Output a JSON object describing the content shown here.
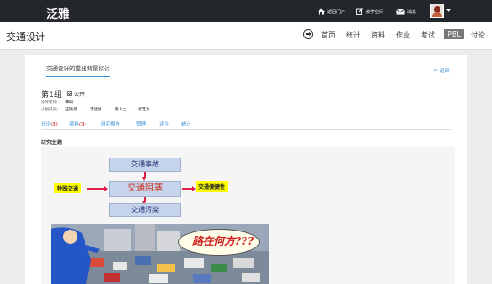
{
  "topbar": {
    "brand": "泛雅",
    "links": [
      "返回门户",
      "教学空间",
      "消息"
    ]
  },
  "header": {
    "title": "交通设计",
    "nav": [
      "首页",
      "统计",
      "资料",
      "作业",
      "考试",
      "PBL",
      "讨论"
    ],
    "active_nav": "PBL"
  },
  "panel": {
    "tab": "交通设计的提出背景探讨",
    "back": "返回",
    "group_name": "第1组",
    "public_label": "公开",
    "teacher_label": "指导教师：",
    "teacher": "朱琪",
    "members_label": "小组成员：",
    "members": [
      "王晓月",
      "李佳妮",
      "荆人士",
      "郑芝龙"
    ],
    "tabs": [
      {
        "label": "讨论",
        "count": "(3)"
      },
      {
        "label": "资料",
        "count": "(3)"
      },
      {
        "label": "研究报告",
        "count": ""
      },
      {
        "label": "管理",
        "count": ""
      },
      {
        "label": "评价",
        "count": ""
      },
      {
        "label": "统计",
        "count": ""
      }
    ],
    "section_title": "研究主题"
  },
  "diagram": {
    "top": "交通事故",
    "center": "交通阻塞",
    "bottom": "交通污染",
    "left": "特殊交通",
    "right": "交通便捷性"
  },
  "cartoon": {
    "caption": "路在何方???"
  },
  "colors": {
    "topbar": "#23272b",
    "link": "#3b8fd4",
    "count": "#cc0000",
    "diagram_box": "#c6d4ec",
    "highlight": "#ffff00",
    "arrow": "#e0204a"
  }
}
